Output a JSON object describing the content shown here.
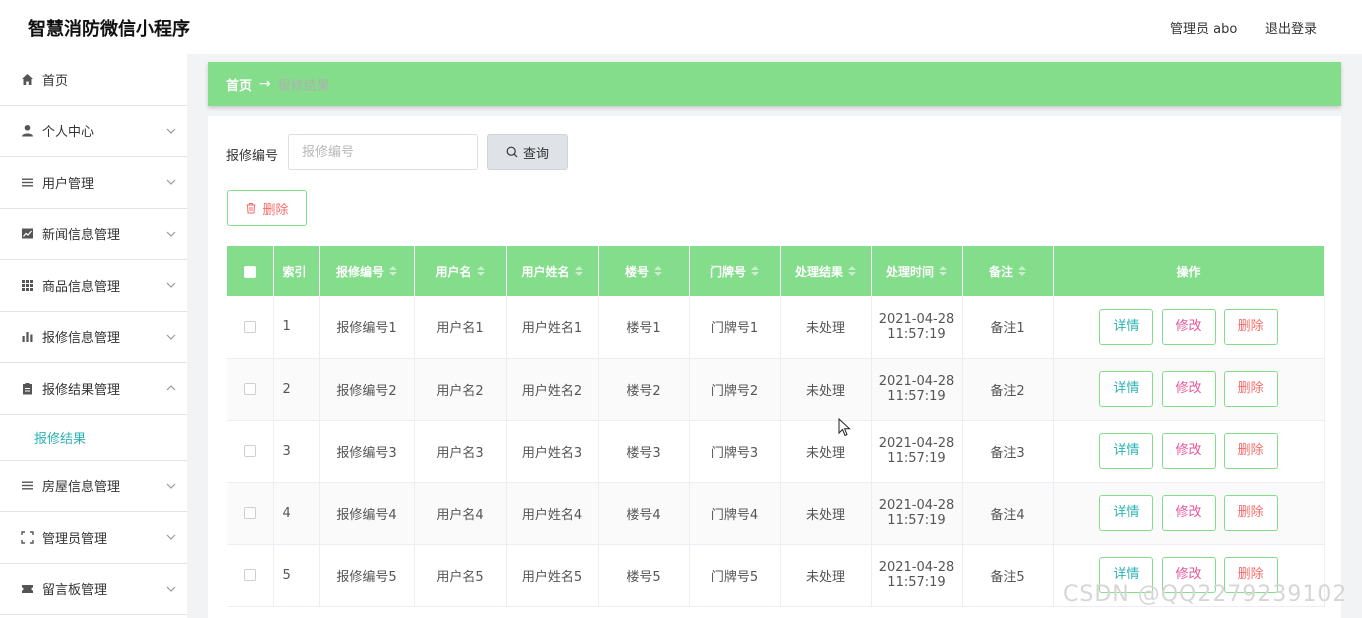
{
  "header": {
    "app_title": "智慧消防微信小程序",
    "user": "管理员 abo",
    "logout": "退出登录"
  },
  "sidebar": {
    "items": [
      {
        "label": "首页",
        "icon": "home-icon",
        "has_chevron": false
      },
      {
        "label": "个人中心",
        "icon": "user-icon",
        "has_chevron": true
      },
      {
        "label": "用户管理",
        "icon": "list-icon",
        "has_chevron": true
      },
      {
        "label": "新闻信息管理",
        "icon": "chart-icon",
        "has_chevron": true
      },
      {
        "label": "商品信息管理",
        "icon": "grid-icon",
        "has_chevron": true
      },
      {
        "label": "报修信息管理",
        "icon": "bar-chart-icon",
        "has_chevron": true
      },
      {
        "label": "报修结果管理",
        "icon": "clipboard-icon",
        "has_chevron": true,
        "expanded": true,
        "children": [
          {
            "label": "报修结果"
          }
        ]
      },
      {
        "label": "房屋信息管理",
        "icon": "list-icon",
        "has_chevron": true
      },
      {
        "label": "管理员管理",
        "icon": "frame-icon",
        "has_chevron": true
      },
      {
        "label": "留言板管理",
        "icon": "ticket-icon",
        "has_chevron": true
      }
    ]
  },
  "breadcrumb": {
    "home": "首页",
    "separator": "→",
    "current": "报修结果"
  },
  "search": {
    "label": "报修编号",
    "placeholder": "报修编号",
    "value": "",
    "button": "查询"
  },
  "toolbar": {
    "delete": "删除"
  },
  "table": {
    "columns": [
      "索引",
      "报修编号",
      "用户名",
      "用户姓名",
      "楼号",
      "门牌号",
      "处理结果",
      "处理时间",
      "备注",
      "操作"
    ],
    "actions": {
      "detail": "详情",
      "edit": "修改",
      "delete": "删除"
    },
    "rows": [
      {
        "index": "1",
        "repair_no": "报修编号1",
        "username": "用户名1",
        "name": "用户姓名1",
        "building": "楼号1",
        "door": "门牌号1",
        "result": "未处理",
        "date": "2021-04-28",
        "time": "11:57:19",
        "note": "备注1"
      },
      {
        "index": "2",
        "repair_no": "报修编号2",
        "username": "用户名2",
        "name": "用户姓名2",
        "building": "楼号2",
        "door": "门牌号2",
        "result": "未处理",
        "date": "2021-04-28",
        "time": "11:57:19",
        "note": "备注2"
      },
      {
        "index": "3",
        "repair_no": "报修编号3",
        "username": "用户名3",
        "name": "用户姓名3",
        "building": "楼号3",
        "door": "门牌号3",
        "result": "未处理",
        "date": "2021-04-28",
        "time": "11:57:19",
        "note": "备注3"
      },
      {
        "index": "4",
        "repair_no": "报修编号4",
        "username": "用户名4",
        "name": "用户姓名4",
        "building": "楼号4",
        "door": "门牌号4",
        "result": "未处理",
        "date": "2021-04-28",
        "time": "11:57:19",
        "note": "备注4"
      },
      {
        "index": "5",
        "repair_no": "报修编号5",
        "username": "用户名5",
        "name": "用户姓名5",
        "building": "楼号5",
        "door": "门牌号5",
        "result": "未处理",
        "date": "2021-04-28",
        "time": "11:57:19",
        "note": "备注5"
      }
    ]
  },
  "watermark": "CSDN @QQ2279239102",
  "colors": {
    "accent": "#83dd8a",
    "detail": "#2bb3b3",
    "edit": "#e8569a",
    "delete": "#f56c6c"
  }
}
